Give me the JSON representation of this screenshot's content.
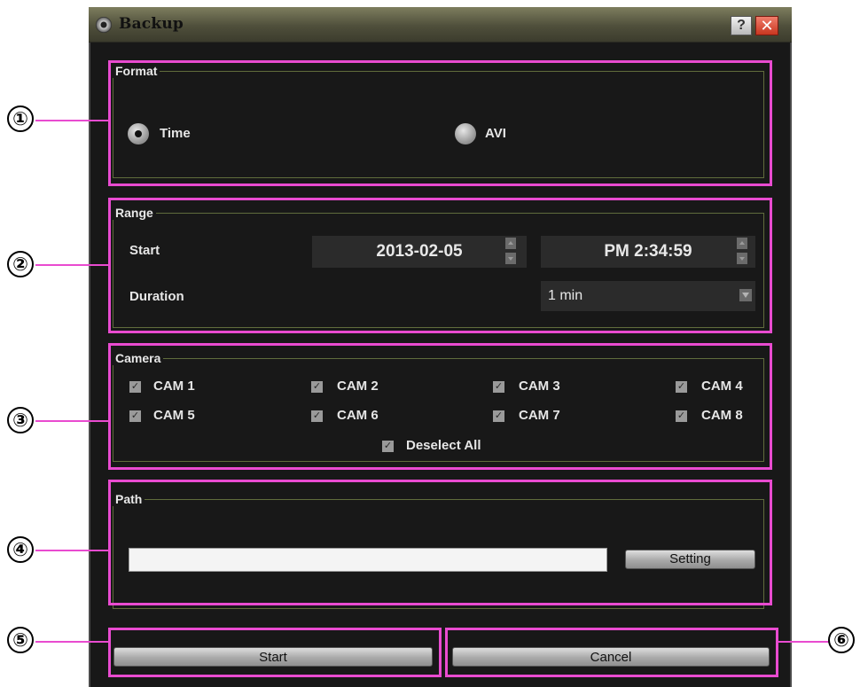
{
  "window": {
    "title": "Backup",
    "help_label": "?",
    "close_label": "✕"
  },
  "format": {
    "legend": "Format",
    "options": [
      {
        "label": "Time",
        "selected": true
      },
      {
        "label": "AVI",
        "selected": false
      }
    ]
  },
  "range": {
    "legend": "Range",
    "start_label": "Start",
    "start_date": "2013-02-05",
    "start_time": "PM 2:34:59",
    "duration_label": "Duration",
    "duration_value": "1 min"
  },
  "camera": {
    "legend": "Camera",
    "cams": [
      "CAM 1",
      "CAM 2",
      "CAM 3",
      "CAM 4",
      "CAM 5",
      "CAM 6",
      "CAM 7",
      "CAM 8"
    ],
    "deselect_all": "Deselect All"
  },
  "path": {
    "legend": "Path",
    "value": "",
    "setting_label": "Setting"
  },
  "actions": {
    "start_label": "Start",
    "cancel_label": "Cancel"
  },
  "callouts": [
    "①",
    "②",
    "③",
    "④",
    "⑤",
    "⑥"
  ],
  "colors": {
    "callout": "#e94bd0",
    "window_bg": "#181818",
    "group_border": "#606c3c"
  }
}
